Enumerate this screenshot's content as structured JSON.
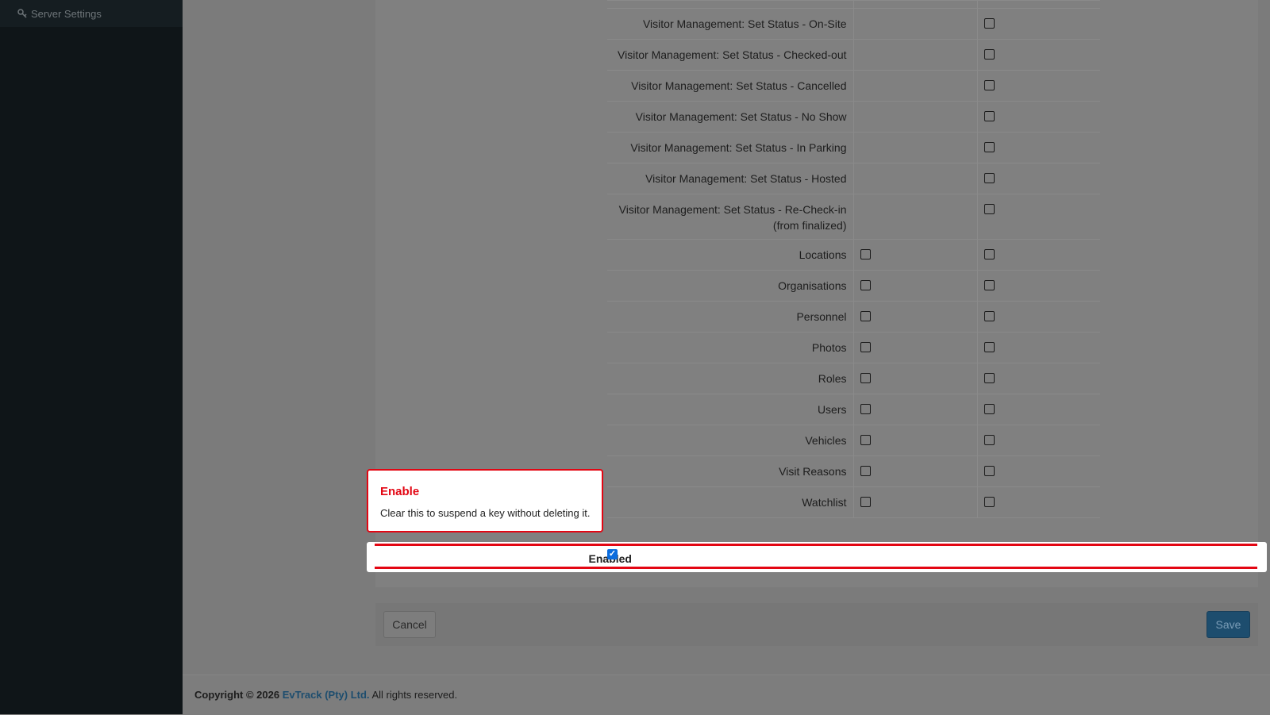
{
  "sidebar": {
    "items": [
      {
        "label": "Server Settings",
        "icon": "key-icon"
      }
    ]
  },
  "permissions": {
    "rows": [
      {
        "label": "",
        "col1": false,
        "col2": false
      },
      {
        "label": "Visitor Management: Set Status - On-Site",
        "col1": null,
        "col2": false
      },
      {
        "label": "Visitor Management: Set Status - Checked-out",
        "col1": null,
        "col2": false
      },
      {
        "label": "Visitor Management: Set Status - Cancelled",
        "col1": null,
        "col2": false
      },
      {
        "label": "Visitor Management: Set Status - No Show",
        "col1": null,
        "col2": false
      },
      {
        "label": "Visitor Management: Set Status - In Parking",
        "col1": null,
        "col2": false
      },
      {
        "label": "Visitor Management: Set Status - Hosted",
        "col1": null,
        "col2": false
      },
      {
        "label": "Visitor Management: Set Status - Re-Check-in (from finalized)",
        "col1": null,
        "col2": false
      },
      {
        "label": "Locations",
        "col1": false,
        "col2": false
      },
      {
        "label": "Organisations",
        "col1": false,
        "col2": false
      },
      {
        "label": "Personnel",
        "col1": false,
        "col2": false
      },
      {
        "label": "Photos",
        "col1": false,
        "col2": false
      },
      {
        "label": "Roles",
        "col1": false,
        "col2": false
      },
      {
        "label": "Users",
        "col1": false,
        "col2": false
      },
      {
        "label": "Vehicles",
        "col1": false,
        "col2": false
      },
      {
        "label": "Visit Reasons",
        "col1": false,
        "col2": false
      },
      {
        "label": "Watchlist",
        "col1": false,
        "col2": false
      }
    ]
  },
  "enabled": {
    "label": "Enabled",
    "checked": true
  },
  "tooltip": {
    "title": "Enable",
    "body": "Clear this to suspend a key without deleting it."
  },
  "actions": {
    "cancel_label": "Cancel",
    "save_label": "Save"
  },
  "footer": {
    "prefix": "Copyright © 2026",
    "company": "EvTrack (Pty) Ltd.",
    "suffix": "All rights reserved."
  },
  "colors": {
    "highlight": "#e30613",
    "brand": "#1d4d6e",
    "checkbox_checked": "#0a6cde"
  }
}
